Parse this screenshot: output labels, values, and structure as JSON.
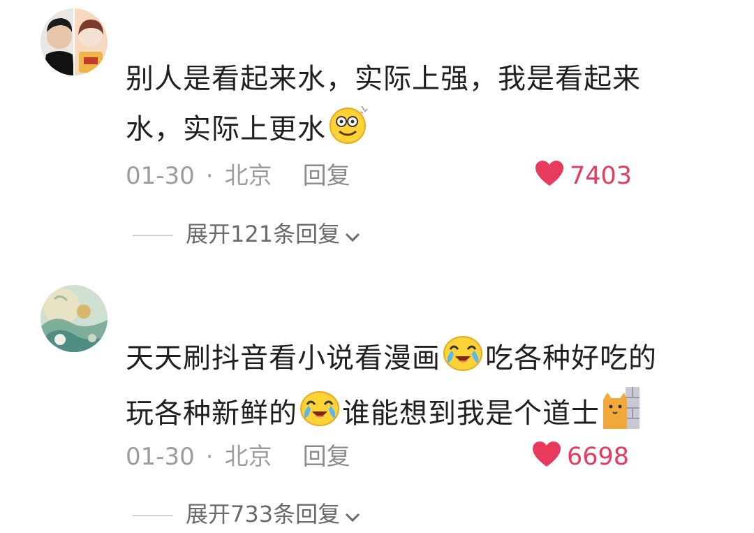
{
  "comments": [
    {
      "text_line1": "别人是看起来水，实际上强，我是看起来",
      "text_line2": "水，实际上更水",
      "emoji_1": "dizzy-smile-emoji",
      "date": "01-30",
      "separator": "·",
      "location": "北京",
      "reply_label": "回复",
      "likes": "7403",
      "expand_label": "展开121条回复"
    },
    {
      "text_line1_a": "天天刷抖音看小说看漫画",
      "text_line1_b": "吃各种好吃的",
      "text_line2_a": "玩各种新鲜的",
      "text_line2_b": "谁能想到我是个道士",
      "emoji_1": "crying-laughing-emoji",
      "emoji_2": "crying-laughing-emoji",
      "emoji_3": "peeking-cat-emoji",
      "date": "01-30",
      "separator": "·",
      "location": "北京",
      "reply_label": "回复",
      "likes": "6698",
      "expand_label": "展开733条回复"
    }
  ],
  "colors": {
    "like": "#e83a5c",
    "meta": "#9c9c9c",
    "text": "#1f1f1f"
  }
}
